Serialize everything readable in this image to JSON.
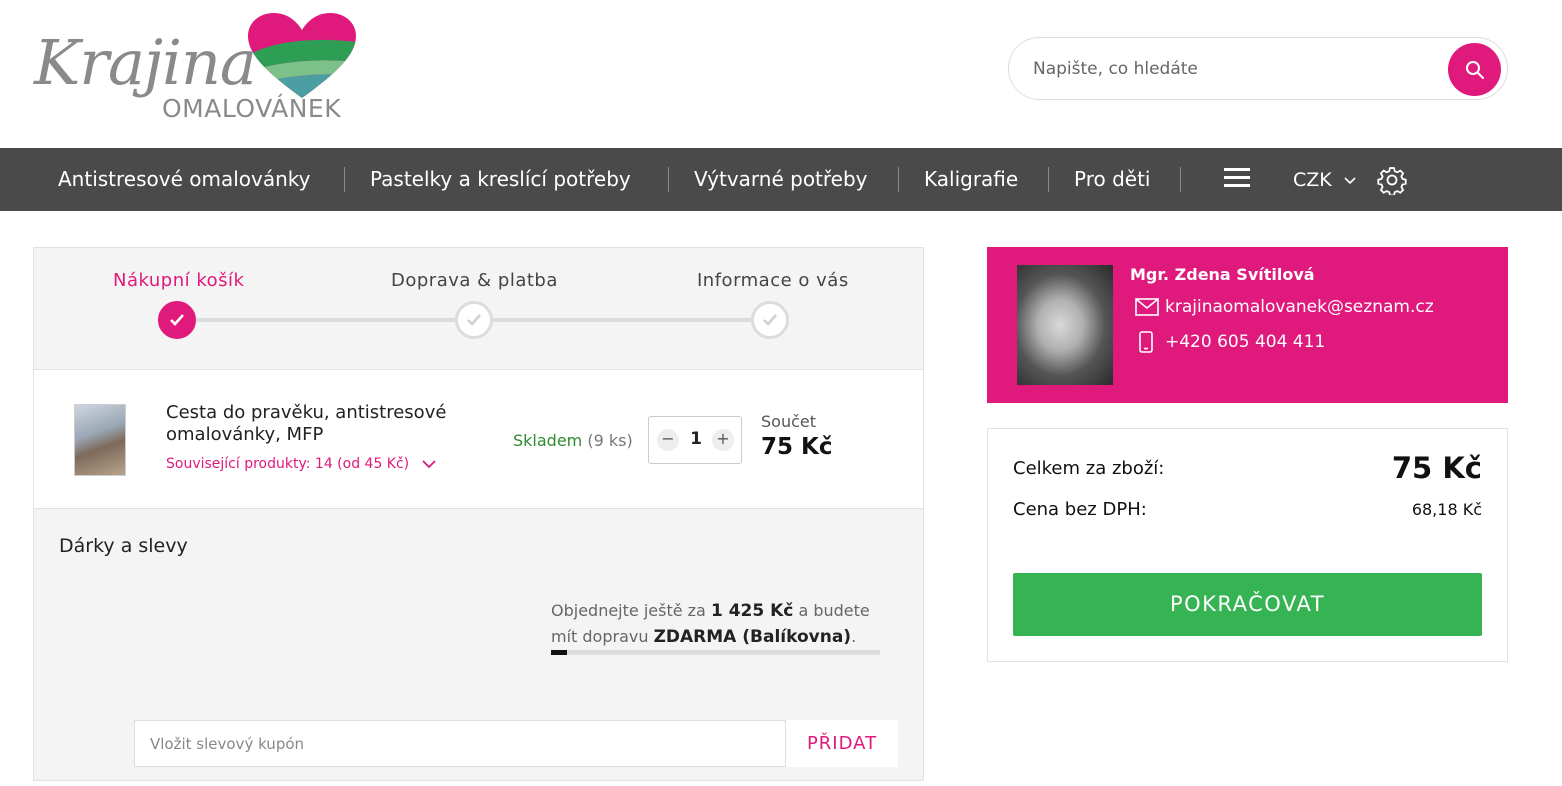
{
  "brand": {
    "logo_main": "Krajina",
    "logo_sub": "OMALOVÁNEK",
    "colors": {
      "accent": "#e0197d",
      "nav_bg": "#4a4a4a",
      "success": "#36b352",
      "stock": "#2e8b2e"
    }
  },
  "search": {
    "placeholder": "Napište, co hledáte",
    "icon": "search-icon"
  },
  "nav": {
    "items": [
      {
        "label": "Antistresové omalovánky"
      },
      {
        "label": "Pastelky a kreslící potřeby"
      },
      {
        "label": "Výtvarné potřeby"
      },
      {
        "label": "Kaligrafie"
      },
      {
        "label": "Pro děti"
      }
    ],
    "menu_icon": "hamburger-icon",
    "currency": "CZK",
    "settings_icon": "gear-icon"
  },
  "steps": [
    {
      "label": "Nákupní košík",
      "active": true
    },
    {
      "label": "Doprava & platba",
      "active": false
    },
    {
      "label": "Informace o vás",
      "active": false
    }
  ],
  "cart": {
    "item": {
      "name": "Cesta do pravěku, antistresové omalovánky, MFP",
      "related": "Související produkty: 14 (od 45 Kč)",
      "stock_label": "Skladem",
      "stock_qty": "(9 ks)",
      "quantity": "1",
      "sum_label": "Součet",
      "sum_value": "75 Kč"
    },
    "gifts_title": "Dárky a slevy",
    "shipping": {
      "text_before": "Objednejte ještě za ",
      "amount": "1 425 Kč",
      "text_middle": " a budete mít dopravu ",
      "free_label": "ZDARMA (Balíkovna)",
      "text_after": ".",
      "progress": 0.05
    },
    "coupon": {
      "placeholder": "Vložit slevový kupón",
      "button": "PŘIDAT"
    }
  },
  "contact": {
    "name": "Mgr. Zdena Svítilová",
    "email": "krajinaomalovanek@seznam.cz",
    "phone": "+420 605 404 411"
  },
  "summary": {
    "total_label": "Celkem za zboží:",
    "total_value": "75 Kč",
    "net_label": "Cena bez DPH:",
    "net_value": "68,18 Kč",
    "continue_button": "POKRAČOVAT"
  }
}
